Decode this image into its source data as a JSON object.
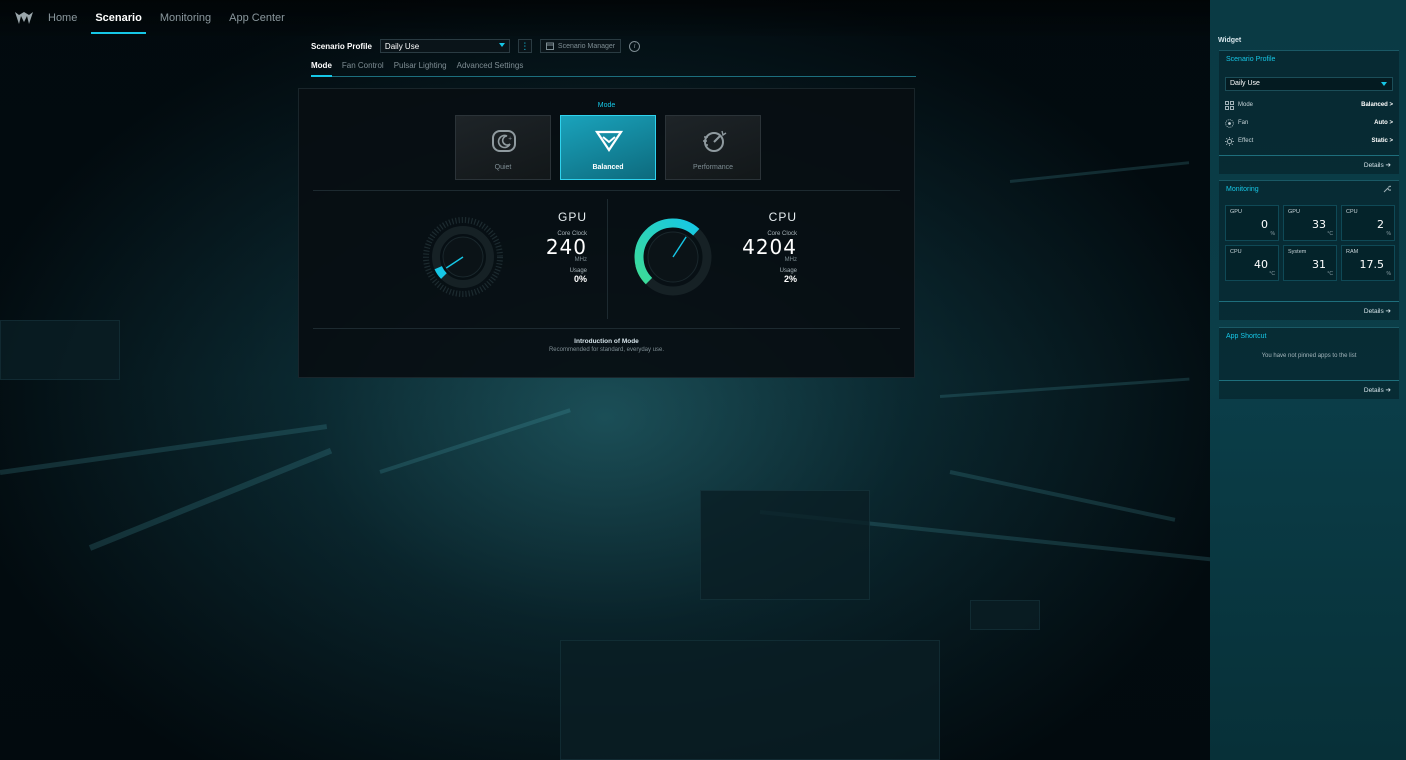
{
  "topbar": {
    "nav": [
      "Home",
      "Scenario",
      "Monitoring",
      "App Center"
    ],
    "active_nav": "Scenario"
  },
  "scenario": {
    "profile_label": "Scenario Profile",
    "profile_value": "Daily Use",
    "manager_label": "Scenario Manager",
    "info_glyph": "i",
    "tabs": [
      "Mode",
      "Fan Control",
      "Pulsar Lighting",
      "Advanced Settings"
    ],
    "active_tab": "Mode"
  },
  "mode": {
    "title": "Mode",
    "cards": [
      {
        "label": "Quiet",
        "icon": "quiet-mode-icon",
        "active": false
      },
      {
        "label": "Balanced",
        "icon": "balanced-mode-icon",
        "active": true
      },
      {
        "label": "Performance",
        "icon": "performance-mode-icon",
        "active": false
      }
    ],
    "intro_title": "Introduction of Mode",
    "intro_desc": "Recommended for standard, everyday use."
  },
  "gpu": {
    "name": "GPU",
    "clock_label": "Core Clock",
    "clock_value": "240",
    "clock_unit": "MHz",
    "usage_label": "Usage",
    "usage_value": "0%",
    "gauge_fraction": 0.08
  },
  "cpu": {
    "name": "CPU",
    "clock_label": "Core Clock",
    "clock_value": "4204",
    "clock_unit": "MHz",
    "usage_label": "Usage",
    "usage_value": "2%",
    "gauge_fraction": 0.66
  },
  "widget": {
    "title": "Widget",
    "scenario_profile": {
      "title": "Scenario Profile",
      "selected": "Daily Use",
      "rows": [
        {
          "name": "Mode",
          "value": "Balanced >",
          "icon": "mode-grid-icon"
        },
        {
          "name": "Fan",
          "value": "Auto >",
          "icon": "fan-icon"
        },
        {
          "name": "Effect",
          "value": "Static >",
          "icon": "effect-sun-icon"
        }
      ],
      "details": "Details ➔"
    },
    "monitoring": {
      "title": "Monitoring",
      "cells": [
        {
          "label": "GPU",
          "value": "0",
          "unit": "%"
        },
        {
          "label": "GPU",
          "value": "33",
          "unit": "°C"
        },
        {
          "label": "CPU",
          "value": "2",
          "unit": "%"
        },
        {
          "label": "CPU",
          "value": "40",
          "unit": "°C"
        },
        {
          "label": "System",
          "value": "31",
          "unit": "°C"
        },
        {
          "label": "RAM",
          "value": "17.5",
          "unit": "%"
        }
      ],
      "details": "Details ➔"
    },
    "app_shortcut": {
      "title": "App Shortcut",
      "empty": "You have not pinned apps to the list",
      "details": "Details ➔"
    }
  },
  "colors": {
    "accent": "#16c7e6",
    "gauge_green": "#3ddc97",
    "sidebar_bg": "#0a3a44"
  }
}
